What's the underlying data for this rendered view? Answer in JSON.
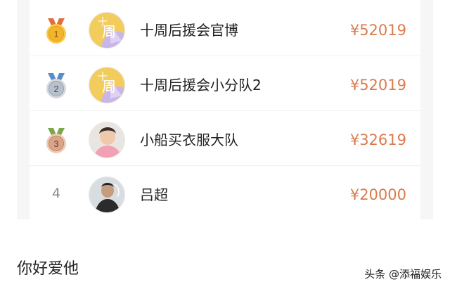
{
  "ranking": {
    "entries": [
      {
        "rank": "1",
        "medal": "gold",
        "name": "十周后援会官博",
        "amount": "¥52019"
      },
      {
        "rank": "2",
        "medal": "silver",
        "name": "十周后援会小分队2",
        "amount": "¥52019"
      },
      {
        "rank": "3",
        "medal": "bronze",
        "name": "小船买衣服大队",
        "amount": "¥32619"
      },
      {
        "rank": "4",
        "medal": "none",
        "name": "吕超",
        "amount": "¥20000"
      }
    ]
  },
  "article": {
    "heading": "你好爱他"
  },
  "watermark": {
    "text": "头条 @添福娱乐"
  },
  "colors": {
    "amount": "#d97b4e",
    "gold": "#f2b52c",
    "silver": "#b8c0cc",
    "bronze": "#d9a58a"
  }
}
